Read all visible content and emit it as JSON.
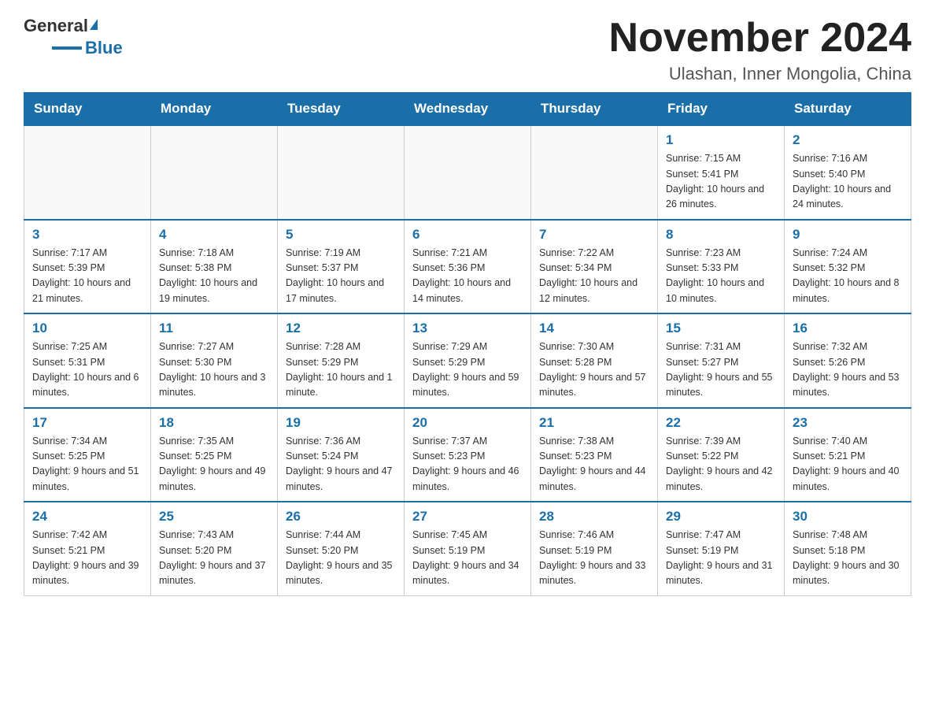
{
  "logo": {
    "general": "General",
    "triangle": "",
    "blue": "Blue"
  },
  "header": {
    "title": "November 2024",
    "location": "Ulashan, Inner Mongolia, China"
  },
  "weekdays": [
    "Sunday",
    "Monday",
    "Tuesday",
    "Wednesday",
    "Thursday",
    "Friday",
    "Saturday"
  ],
  "weeks": [
    [
      {
        "day": "",
        "info": ""
      },
      {
        "day": "",
        "info": ""
      },
      {
        "day": "",
        "info": ""
      },
      {
        "day": "",
        "info": ""
      },
      {
        "day": "",
        "info": ""
      },
      {
        "day": "1",
        "info": "Sunrise: 7:15 AM\nSunset: 5:41 PM\nDaylight: 10 hours and 26 minutes."
      },
      {
        "day": "2",
        "info": "Sunrise: 7:16 AM\nSunset: 5:40 PM\nDaylight: 10 hours and 24 minutes."
      }
    ],
    [
      {
        "day": "3",
        "info": "Sunrise: 7:17 AM\nSunset: 5:39 PM\nDaylight: 10 hours and 21 minutes."
      },
      {
        "day": "4",
        "info": "Sunrise: 7:18 AM\nSunset: 5:38 PM\nDaylight: 10 hours and 19 minutes."
      },
      {
        "day": "5",
        "info": "Sunrise: 7:19 AM\nSunset: 5:37 PM\nDaylight: 10 hours and 17 minutes."
      },
      {
        "day": "6",
        "info": "Sunrise: 7:21 AM\nSunset: 5:36 PM\nDaylight: 10 hours and 14 minutes."
      },
      {
        "day": "7",
        "info": "Sunrise: 7:22 AM\nSunset: 5:34 PM\nDaylight: 10 hours and 12 minutes."
      },
      {
        "day": "8",
        "info": "Sunrise: 7:23 AM\nSunset: 5:33 PM\nDaylight: 10 hours and 10 minutes."
      },
      {
        "day": "9",
        "info": "Sunrise: 7:24 AM\nSunset: 5:32 PM\nDaylight: 10 hours and 8 minutes."
      }
    ],
    [
      {
        "day": "10",
        "info": "Sunrise: 7:25 AM\nSunset: 5:31 PM\nDaylight: 10 hours and 6 minutes."
      },
      {
        "day": "11",
        "info": "Sunrise: 7:27 AM\nSunset: 5:30 PM\nDaylight: 10 hours and 3 minutes."
      },
      {
        "day": "12",
        "info": "Sunrise: 7:28 AM\nSunset: 5:29 PM\nDaylight: 10 hours and 1 minute."
      },
      {
        "day": "13",
        "info": "Sunrise: 7:29 AM\nSunset: 5:29 PM\nDaylight: 9 hours and 59 minutes."
      },
      {
        "day": "14",
        "info": "Sunrise: 7:30 AM\nSunset: 5:28 PM\nDaylight: 9 hours and 57 minutes."
      },
      {
        "day": "15",
        "info": "Sunrise: 7:31 AM\nSunset: 5:27 PM\nDaylight: 9 hours and 55 minutes."
      },
      {
        "day": "16",
        "info": "Sunrise: 7:32 AM\nSunset: 5:26 PM\nDaylight: 9 hours and 53 minutes."
      }
    ],
    [
      {
        "day": "17",
        "info": "Sunrise: 7:34 AM\nSunset: 5:25 PM\nDaylight: 9 hours and 51 minutes."
      },
      {
        "day": "18",
        "info": "Sunrise: 7:35 AM\nSunset: 5:25 PM\nDaylight: 9 hours and 49 minutes."
      },
      {
        "day": "19",
        "info": "Sunrise: 7:36 AM\nSunset: 5:24 PM\nDaylight: 9 hours and 47 minutes."
      },
      {
        "day": "20",
        "info": "Sunrise: 7:37 AM\nSunset: 5:23 PM\nDaylight: 9 hours and 46 minutes."
      },
      {
        "day": "21",
        "info": "Sunrise: 7:38 AM\nSunset: 5:23 PM\nDaylight: 9 hours and 44 minutes."
      },
      {
        "day": "22",
        "info": "Sunrise: 7:39 AM\nSunset: 5:22 PM\nDaylight: 9 hours and 42 minutes."
      },
      {
        "day": "23",
        "info": "Sunrise: 7:40 AM\nSunset: 5:21 PM\nDaylight: 9 hours and 40 minutes."
      }
    ],
    [
      {
        "day": "24",
        "info": "Sunrise: 7:42 AM\nSunset: 5:21 PM\nDaylight: 9 hours and 39 minutes."
      },
      {
        "day": "25",
        "info": "Sunrise: 7:43 AM\nSunset: 5:20 PM\nDaylight: 9 hours and 37 minutes."
      },
      {
        "day": "26",
        "info": "Sunrise: 7:44 AM\nSunset: 5:20 PM\nDaylight: 9 hours and 35 minutes."
      },
      {
        "day": "27",
        "info": "Sunrise: 7:45 AM\nSunset: 5:19 PM\nDaylight: 9 hours and 34 minutes."
      },
      {
        "day": "28",
        "info": "Sunrise: 7:46 AM\nSunset: 5:19 PM\nDaylight: 9 hours and 33 minutes."
      },
      {
        "day": "29",
        "info": "Sunrise: 7:47 AM\nSunset: 5:19 PM\nDaylight: 9 hours and 31 minutes."
      },
      {
        "day": "30",
        "info": "Sunrise: 7:48 AM\nSunset: 5:18 PM\nDaylight: 9 hours and 30 minutes."
      }
    ]
  ]
}
